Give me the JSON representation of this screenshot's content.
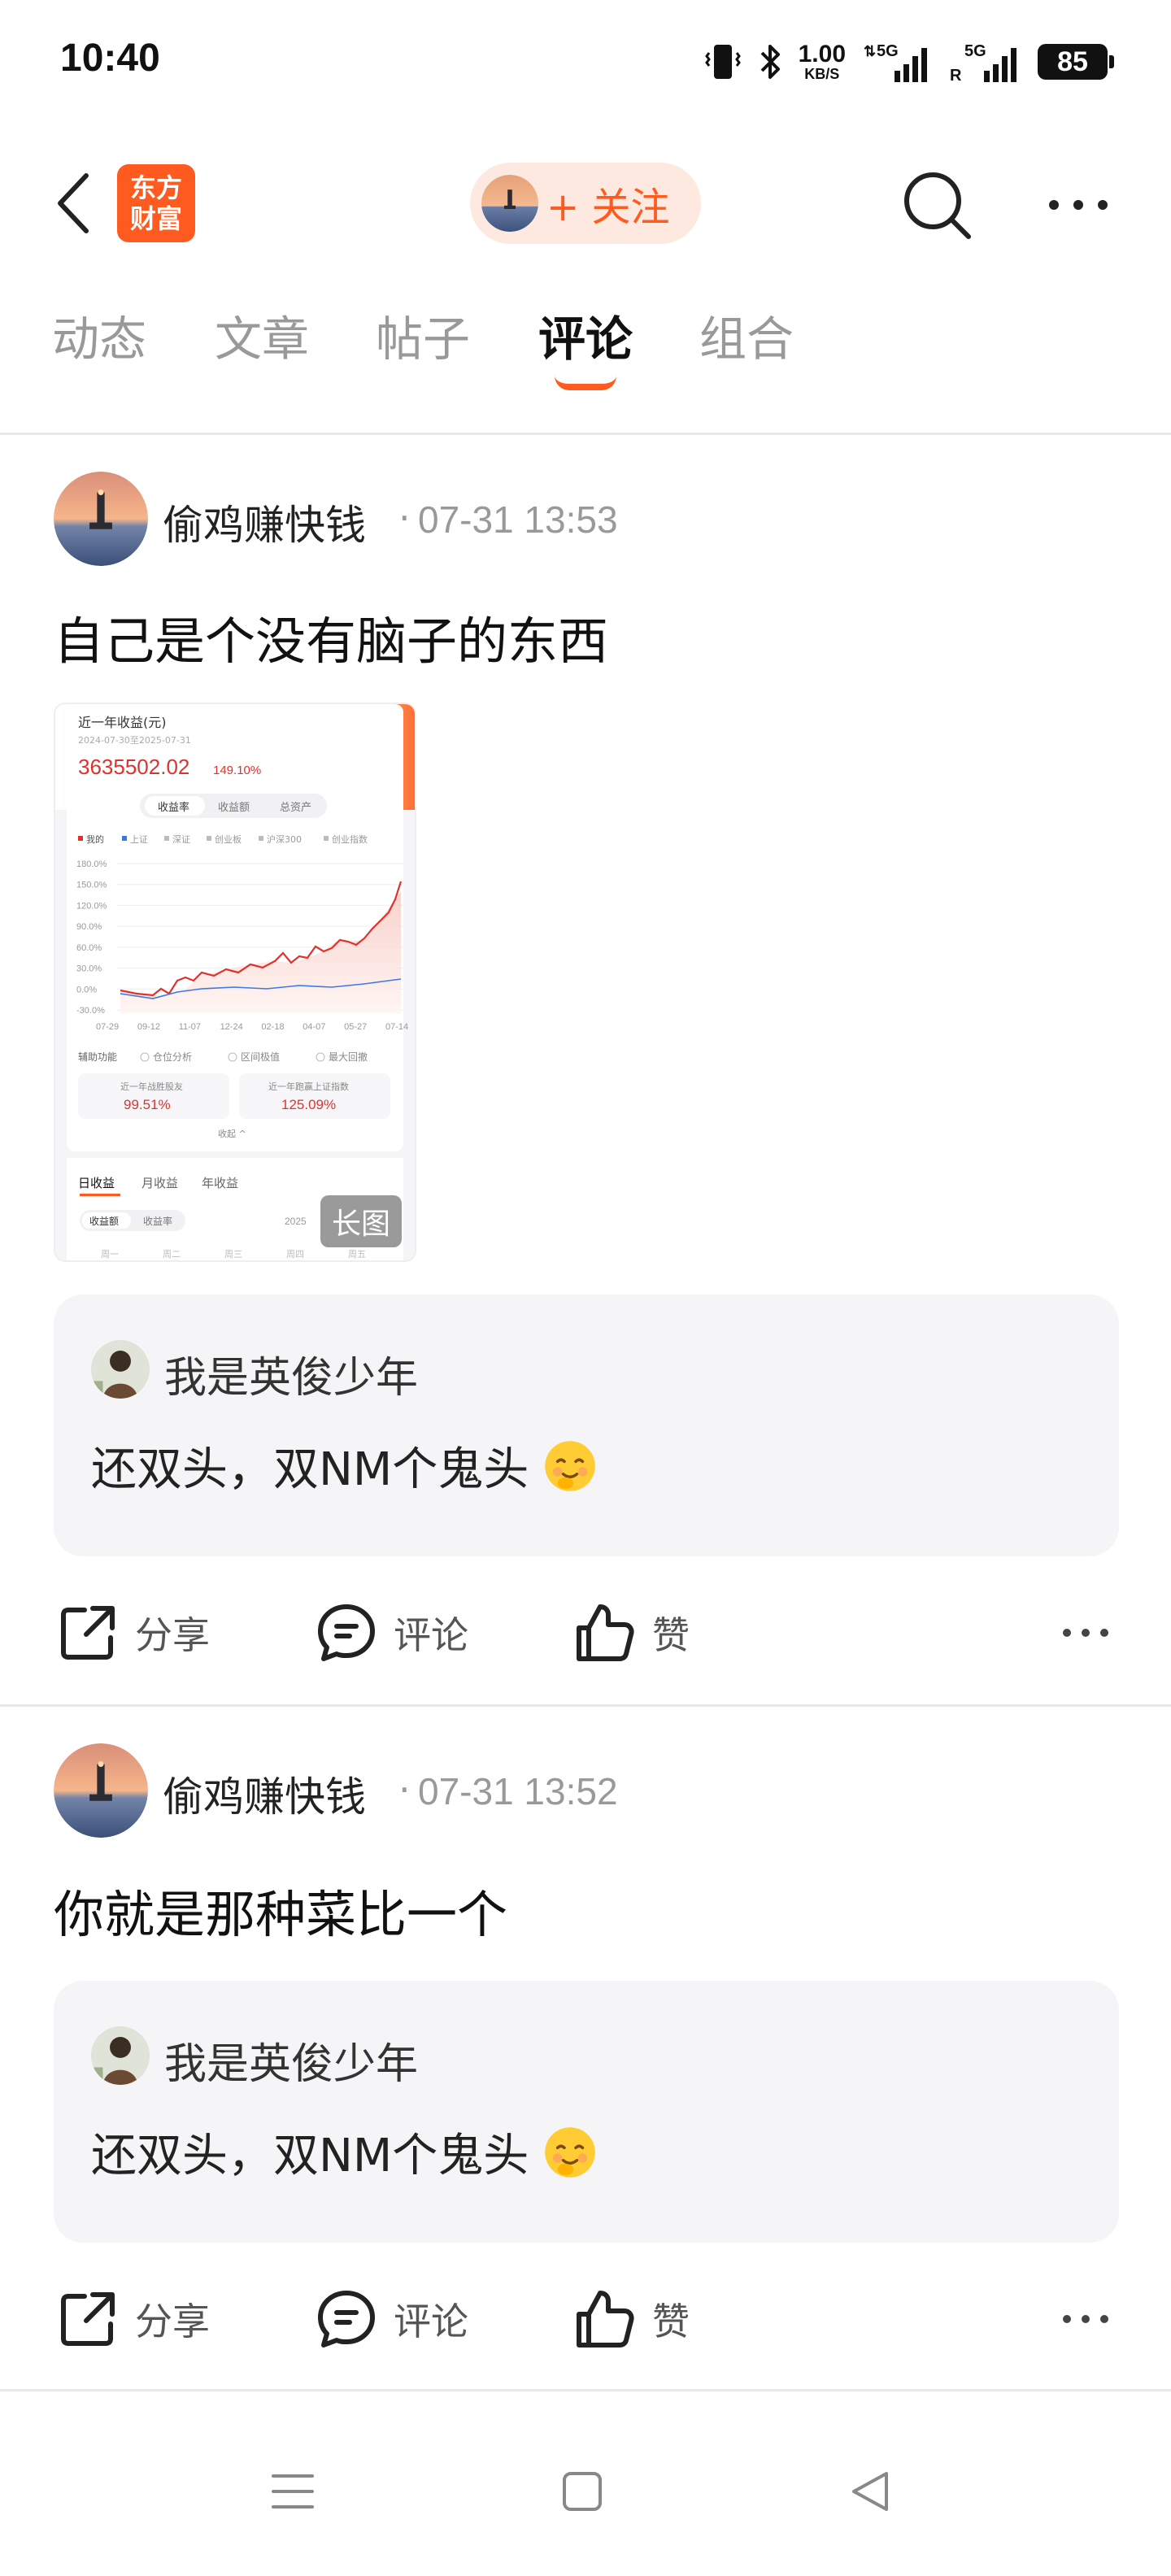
{
  "status_bar": {
    "time": "10:40",
    "net_speed_value": "1.00",
    "net_speed_unit": "KB/S",
    "signal1": "5G",
    "signal2": "5G",
    "signal2_sub": "R",
    "battery": "85"
  },
  "header": {
    "logo_line1": "东方",
    "logo_line2": "财富",
    "follow_label": "+ 关注",
    "accent_color": "#ff5a1f"
  },
  "tabs": [
    {
      "label": "动态",
      "active": false
    },
    {
      "label": "文章",
      "active": false
    },
    {
      "label": "帖子",
      "active": false
    },
    {
      "label": "评论",
      "active": true
    },
    {
      "label": "组合",
      "active": false
    }
  ],
  "posts": [
    {
      "author": "偷鸡赚快钱",
      "sep": "·",
      "time": "07-31 13:53",
      "content": "自己是个没有脑子的东西",
      "quote_author": "我是英俊少年",
      "quote_text": "还双头，双NM个鬼头",
      "actions": {
        "share": "分享",
        "comment": "评论",
        "like": "赞"
      }
    },
    {
      "author": "偷鸡赚快钱",
      "sep": "·",
      "time": "07-31 13:52",
      "content": "你就是那种菜比一个",
      "quote_author": "我是英俊少年",
      "quote_text": "还双头，双NM个鬼头",
      "actions": {
        "share": "分享",
        "comment": "评论",
        "like": "赞"
      }
    }
  ],
  "thumbnail": {
    "title": "近一年收益(元)",
    "date_range": "2024-07-30至2025-07-31",
    "total": "3635502.02",
    "pct": "149.10%",
    "seg_tabs": [
      "收益率",
      "收益额",
      "总资产"
    ],
    "legend": [
      "我的",
      "上证",
      "深证",
      "创业板",
      "沪深300",
      "创业指数"
    ],
    "y_ticks": [
      "180.0%",
      "150.0%",
      "120.0%",
      "90.0%",
      "60.0%",
      "30.0%",
      "0.0%",
      "-30.0%"
    ],
    "x_ticks": [
      "07-29",
      "09-12",
      "11-07",
      "12-24",
      "02-18",
      "04-07",
      "05-27",
      "07-14"
    ],
    "aux_label": "辅助功能",
    "aux_opts": [
      "仓位分析",
      "区间极值",
      "最大回撤"
    ],
    "stat1_label": "近一年战胜股友",
    "stat1_value": "99.51%",
    "stat2_label": "近一年跑赢上证指数",
    "stat2_value": "125.09%",
    "collapse": "收起 ^",
    "bottom_tabs": [
      "日收益",
      "月收益",
      "年收益"
    ],
    "bottom_seg": [
      "收益额",
      "收益率"
    ],
    "bottom_year": "2025",
    "weekdays": [
      "周一",
      "周二",
      "周三",
      "周四",
      "周五"
    ],
    "long_image_badge": "长图"
  }
}
